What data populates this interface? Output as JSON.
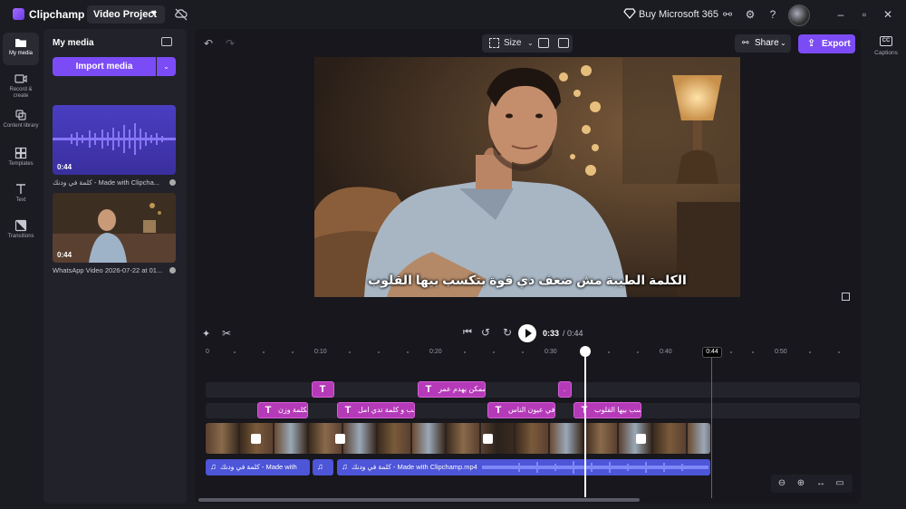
{
  "app": {
    "name": "Clipchamp"
  },
  "project": {
    "title": "Video Project"
  },
  "topbar": {
    "buy_label": "Buy Microsoft 365"
  },
  "nav": [
    {
      "label": "My media"
    },
    {
      "label": "Record & create"
    },
    {
      "label": "Content library"
    },
    {
      "label": "Templates"
    },
    {
      "label": "Text"
    },
    {
      "label": "Transitions"
    }
  ],
  "media": {
    "title": "My media",
    "import_label": "Import media",
    "items": [
      {
        "duration": "0:44",
        "caption": "كلمة في ودنك - Made with Clipcha..."
      },
      {
        "duration": "0:44",
        "caption": "WhatsApp Video 2026-07-22 at 01..."
      }
    ]
  },
  "editor": {
    "size_label": "Size",
    "share_label": "Share",
    "export_label": "Export",
    "subtitle": "الكلمة الطيبة مش ضعف دي قوة بتكسب بيها القلوب",
    "time_current": "0:33",
    "time_total": "/ 0:44",
    "end_marker": "0:44"
  },
  "ruler": [
    {
      "label": "0"
    },
    {
      "label": "0:10"
    },
    {
      "label": "0:20"
    },
    {
      "label": "0:30"
    },
    {
      "label": "0:40"
    },
    {
      "label": "0:50"
    }
  ],
  "text_track_1": [
    {
      "label": ""
    },
    {
      "label": "ممكن يهدم عمر"
    },
    {
      "label": "."
    }
  ],
  "text_track_2": [
    {
      "label": "لكلمة وزن"
    },
    {
      "label": "لب و كلمة تدي امل"
    },
    {
      "label": "في عيون الناس"
    },
    {
      "label": "سب بيها القلوب"
    }
  ],
  "audio_track": [
    {
      "label": "كلمة في ودنك - Made with"
    },
    {
      "label": ""
    },
    {
      "label": "كلمة في ودنك - Made with Clipchamp.mp4"
    }
  ],
  "captions": {
    "label": "Captions",
    "badge": "CC"
  }
}
